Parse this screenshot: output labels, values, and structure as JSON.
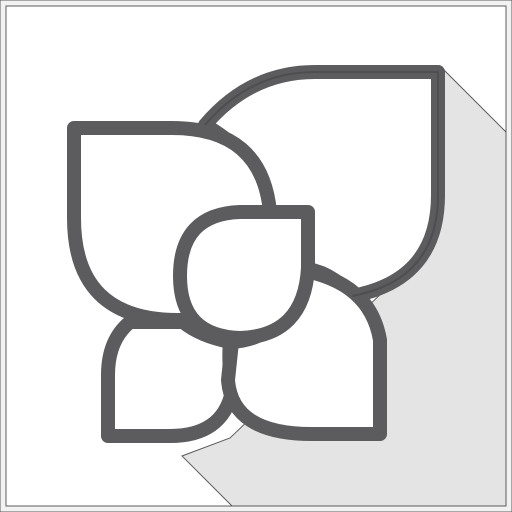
{
  "app_icon": {
    "icon": "petal-flower-icon",
    "colors": {
      "background": "#ffffff",
      "frame": "#f2f2f2",
      "long_shadow": "#e4e4e4",
      "outline": "#5c5c5e",
      "outline_edge": "#3f3f41",
      "petal_fill": "#ffffff"
    }
  }
}
